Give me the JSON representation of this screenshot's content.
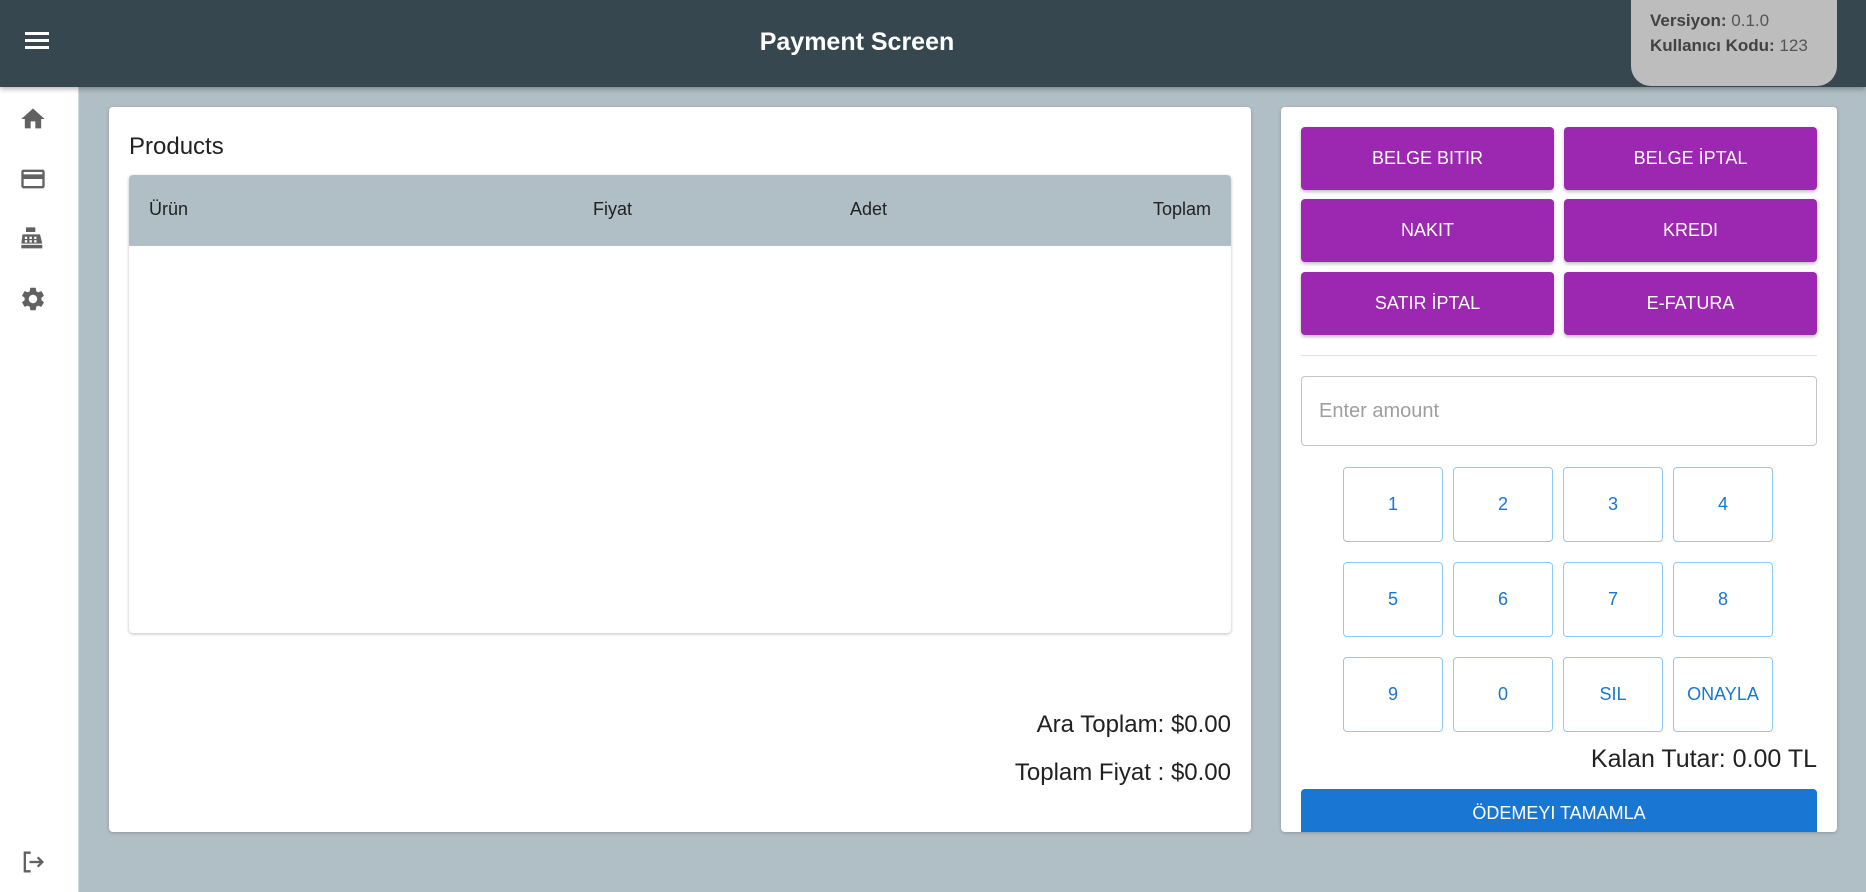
{
  "header": {
    "title": "Payment Screen",
    "version_label": "Versiyon:",
    "version_value": "0.1.0",
    "user_code_label": "Kullanıcı Kodu:",
    "user_code_value": "123"
  },
  "sidebar": {
    "items": [
      {
        "icon": "home-icon"
      },
      {
        "icon": "credit-card-icon"
      },
      {
        "icon": "cash-register-icon"
      },
      {
        "icon": "gear-icon"
      },
      {
        "icon": "logout-icon"
      }
    ]
  },
  "products": {
    "title": "Products",
    "columns": [
      "Ürün",
      "Fiyat",
      "Adet",
      "Toplam"
    ],
    "rows": [],
    "subtotal": "Ara Toplam: $0.00",
    "total": "Toplam Fiyat : $0.00"
  },
  "payment": {
    "actions": [
      "BELGE BITIR",
      "BELGE İPTAL",
      "NAKIT",
      "KREDI",
      "SATIR İPTAL",
      "E-FATURA"
    ],
    "amount_placeholder": "Enter amount",
    "keypad": [
      "1",
      "2",
      "3",
      "4",
      "5",
      "6",
      "7",
      "8",
      "9",
      "0",
      "SIL",
      "ONAYLA"
    ],
    "remaining": "Kalan Tutar: 0.00 TL",
    "complete_label": "ÖDEMEYI TAMAMLA"
  },
  "colors": {
    "appbar": "#37474f",
    "background": "#b0bec5",
    "action_button": "#9c27b0",
    "primary": "#1976d2"
  }
}
